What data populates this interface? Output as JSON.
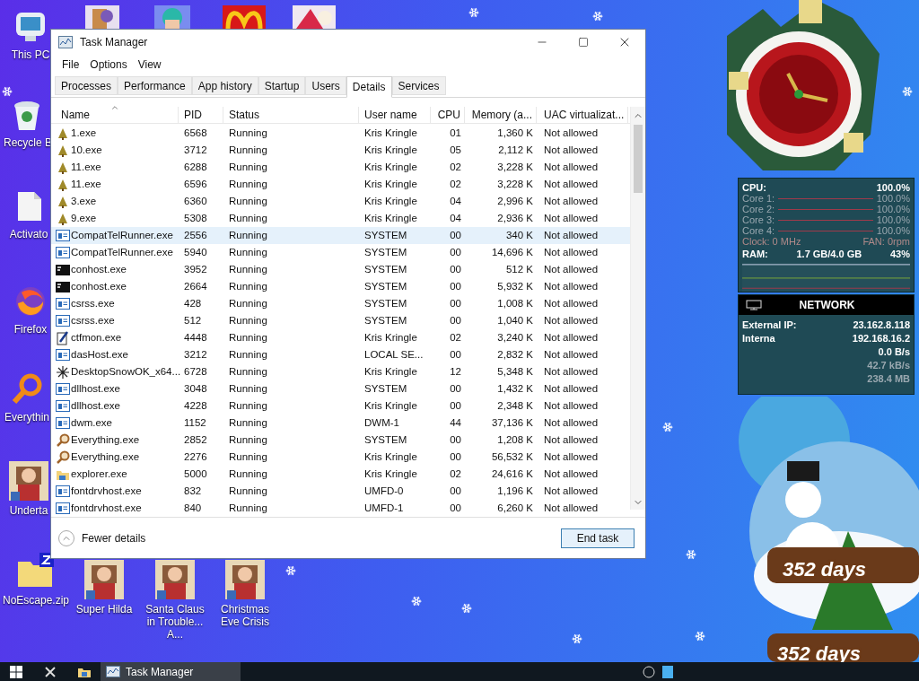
{
  "desktop_icons": [
    {
      "label": "This PC",
      "kind": "pc"
    },
    {
      "label": "Recycle B",
      "kind": "bin"
    },
    {
      "label": "Activato",
      "kind": "doc"
    },
    {
      "label": "Firefox",
      "kind": "firefox"
    },
    {
      "label": "Everythin",
      "kind": "search"
    },
    {
      "label": "Underta",
      "kind": "game"
    }
  ],
  "bottom_icons": [
    {
      "label": "NoEscape.zip",
      "kind": "zip"
    },
    {
      "label": "Super Hilda",
      "kind": "game"
    },
    {
      "label": "Santa Claus in Trouble... A...",
      "kind": "game"
    },
    {
      "label": "Christmas Eve Crisis",
      "kind": "game"
    }
  ],
  "window": {
    "title": "Task Manager"
  },
  "menu": [
    "File",
    "Options",
    "View"
  ],
  "tabs": [
    {
      "label": "Processes",
      "selected": false
    },
    {
      "label": "Performance",
      "selected": false
    },
    {
      "label": "App history",
      "selected": false
    },
    {
      "label": "Startup",
      "selected": false
    },
    {
      "label": "Users",
      "selected": false
    },
    {
      "label": "Details",
      "selected": true
    },
    {
      "label": "Services",
      "selected": false
    }
  ],
  "table": {
    "columns": [
      "Name",
      "PID",
      "Status",
      "User name",
      "CPU",
      "Memory (a...",
      "UAC virtualizat..."
    ],
    "rows": [
      {
        "kind": "tree",
        "cells": [
          "1.exe",
          "6568",
          "Running",
          "Kris Kringle",
          "01",
          "1,360 K",
          "Not allowed"
        ],
        "selected": false
      },
      {
        "kind": "tree",
        "cells": [
          "10.exe",
          "3712",
          "Running",
          "Kris Kringle",
          "05",
          "2,112 K",
          "Not allowed"
        ],
        "selected": false
      },
      {
        "kind": "tree",
        "cells": [
          "11.exe",
          "6288",
          "Running",
          "Kris Kringle",
          "02",
          "3,228 K",
          "Not allowed"
        ],
        "selected": false
      },
      {
        "kind": "tree",
        "cells": [
          "11.exe",
          "6596",
          "Running",
          "Kris Kringle",
          "02",
          "3,228 K",
          "Not allowed"
        ],
        "selected": false
      },
      {
        "kind": "tree",
        "cells": [
          "3.exe",
          "6360",
          "Running",
          "Kris Kringle",
          "04",
          "2,996 K",
          "Not allowed"
        ],
        "selected": false
      },
      {
        "kind": "tree",
        "cells": [
          "9.exe",
          "5308",
          "Running",
          "Kris Kringle",
          "04",
          "2,936 K",
          "Not allowed"
        ],
        "selected": false
      },
      {
        "kind": "window",
        "cells": [
          "CompatTelRunner.exe",
          "2556",
          "Running",
          "SYSTEM",
          "00",
          "340 K",
          "Not allowed"
        ],
        "selected": true
      },
      {
        "kind": "window",
        "cells": [
          "CompatTelRunner.exe",
          "5940",
          "Running",
          "SYSTEM",
          "00",
          "14,696 K",
          "Not allowed"
        ],
        "selected": false
      },
      {
        "kind": "console",
        "cells": [
          "conhost.exe",
          "3952",
          "Running",
          "SYSTEM",
          "00",
          "512 K",
          "Not allowed"
        ],
        "selected": false
      },
      {
        "kind": "console",
        "cells": [
          "conhost.exe",
          "2664",
          "Running",
          "SYSTEM",
          "00",
          "5,932 K",
          "Not allowed"
        ],
        "selected": false
      },
      {
        "kind": "window",
        "cells": [
          "csrss.exe",
          "428",
          "Running",
          "SYSTEM",
          "00",
          "1,008 K",
          "Not allowed"
        ],
        "selected": false
      },
      {
        "kind": "window",
        "cells": [
          "csrss.exe",
          "512",
          "Running",
          "SYSTEM",
          "00",
          "1,040 K",
          "Not allowed"
        ],
        "selected": false
      },
      {
        "kind": "pen",
        "cells": [
          "ctfmon.exe",
          "4448",
          "Running",
          "Kris Kringle",
          "02",
          "3,240 K",
          "Not allowed"
        ],
        "selected": false
      },
      {
        "kind": "window",
        "cells": [
          "dasHost.exe",
          "3212",
          "Running",
          "LOCAL SE...",
          "00",
          "2,832 K",
          "Not allowed"
        ],
        "selected": false
      },
      {
        "kind": "snow",
        "cells": [
          "DesktopSnowOK_x64...",
          "6728",
          "Running",
          "Kris Kringle",
          "12",
          "5,348 K",
          "Not allowed"
        ],
        "selected": false
      },
      {
        "kind": "window",
        "cells": [
          "dllhost.exe",
          "3048",
          "Running",
          "SYSTEM",
          "00",
          "1,432 K",
          "Not allowed"
        ],
        "selected": false
      },
      {
        "kind": "window",
        "cells": [
          "dllhost.exe",
          "4228",
          "Running",
          "Kris Kringle",
          "00",
          "2,348 K",
          "Not allowed"
        ],
        "selected": false
      },
      {
        "kind": "window",
        "cells": [
          "dwm.exe",
          "1152",
          "Running",
          "DWM-1",
          "44",
          "37,136 K",
          "Not allowed"
        ],
        "selected": false
      },
      {
        "kind": "magnifier",
        "cells": [
          "Everything.exe",
          "2852",
          "Running",
          "SYSTEM",
          "00",
          "1,208 K",
          "Not allowed"
        ],
        "selected": false
      },
      {
        "kind": "magnifier",
        "cells": [
          "Everything.exe",
          "2276",
          "Running",
          "Kris Kringle",
          "00",
          "56,532 K",
          "Not allowed"
        ],
        "selected": false
      },
      {
        "kind": "explorer",
        "cells": [
          "explorer.exe",
          "5000",
          "Running",
          "Kris Kringle",
          "02",
          "24,616 K",
          "Not allowed"
        ],
        "selected": false
      },
      {
        "kind": "window",
        "cells": [
          "fontdrvhost.exe",
          "832",
          "Running",
          "UMFD-0",
          "00",
          "1,196 K",
          "Not allowed"
        ],
        "selected": false
      },
      {
        "kind": "window",
        "cells": [
          "fontdrvhost.exe",
          "840",
          "Running",
          "UMFD-1",
          "00",
          "6,260 K",
          "Not allowed"
        ],
        "selected": false
      }
    ]
  },
  "footer": {
    "toggle": "Fewer details",
    "button": "End task"
  },
  "sysmon": {
    "cpu": {
      "label": "CPU:",
      "value": "100.0%"
    },
    "cores": [
      {
        "label": "Core 1:",
        "value": "100.0%"
      },
      {
        "label": "Core 2:",
        "value": "100.0%"
      },
      {
        "label": "Core 3:",
        "value": "100.0%"
      },
      {
        "label": "Core 4:",
        "value": "100.0%"
      }
    ],
    "clock": "Clock: 0 MHz",
    "fan": "FAN: 0rpm",
    "ram": {
      "label": "RAM:",
      "value": "1.7 GB/4.0 GB",
      "percent": "43%"
    }
  },
  "network": {
    "title": "NETWORK",
    "rows": [
      {
        "label": "External IP:",
        "value": "23.162.8.118"
      },
      {
        "label": "Interna",
        "value": "192.168.16.2"
      },
      {
        "value": "0.0 B/s"
      },
      {
        "value": "42.7 kB/s"
      },
      {
        "value": "238.4 MB"
      }
    ]
  },
  "countdowns": [
    "352 days",
    "352 days"
  ],
  "taskbar": {
    "items": [
      {
        "label": "Task Manager",
        "selected": true
      }
    ]
  }
}
